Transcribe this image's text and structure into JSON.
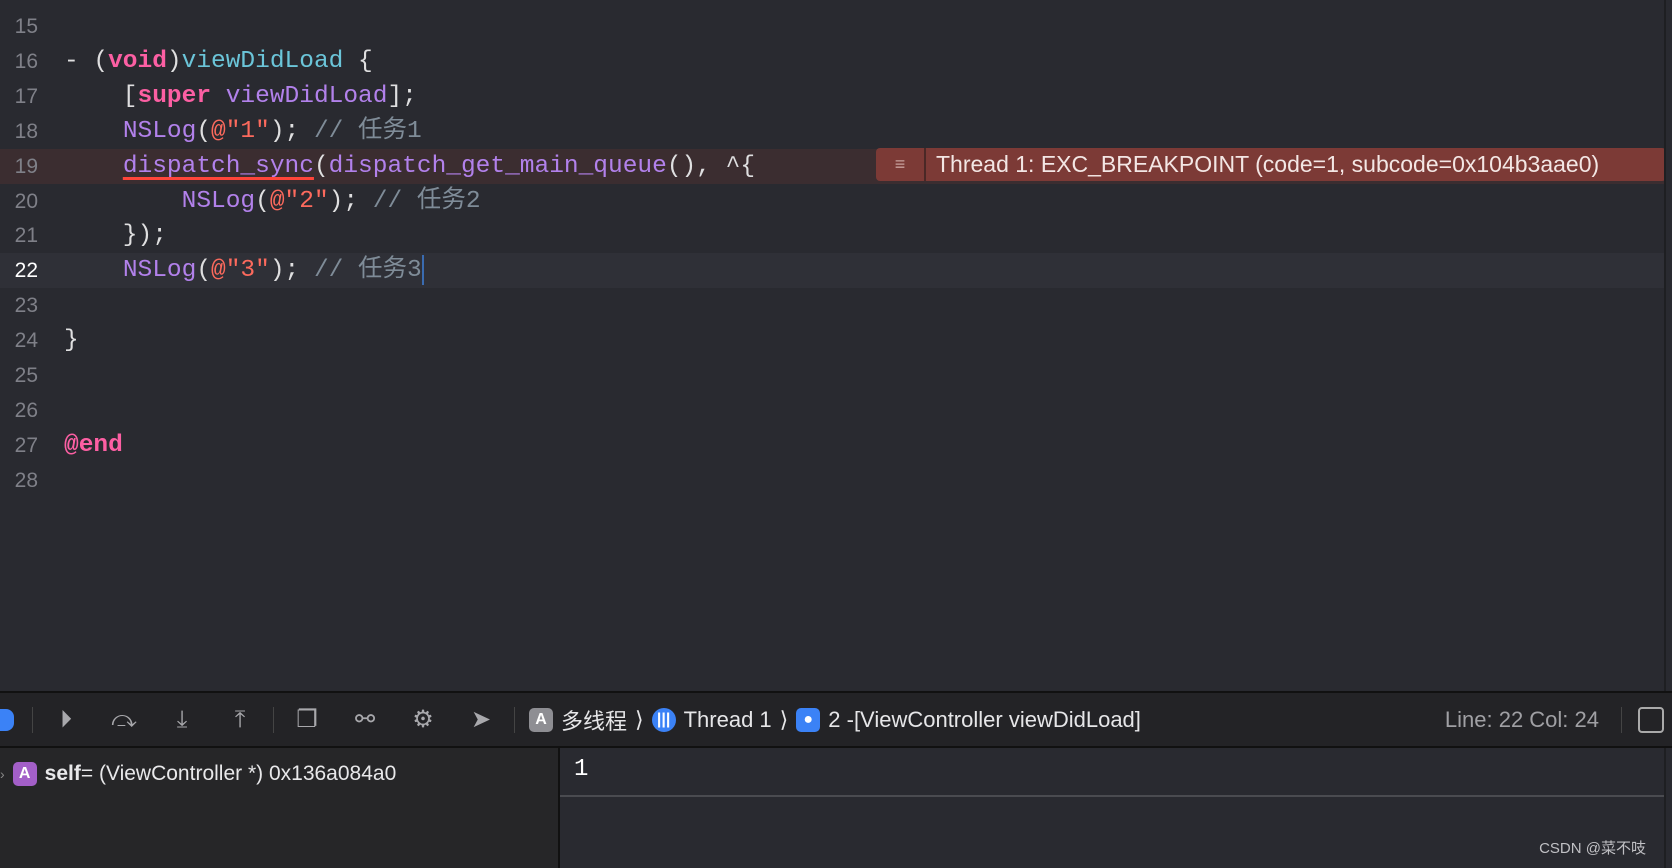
{
  "editor": {
    "lines": [
      {
        "n": "15",
        "tokens": []
      },
      {
        "n": "16",
        "tokens": [
          [
            "- (",
            "pl"
          ],
          [
            "void",
            "kw"
          ],
          [
            ")",
            "pl"
          ],
          [
            "viewDidLoad",
            "fn"
          ],
          [
            " {",
            "pl"
          ]
        ]
      },
      {
        "n": "17",
        "tokens": [
          [
            "    [",
            "pl"
          ],
          [
            "super",
            "kw"
          ],
          [
            " viewDidLoad",
            "mt"
          ],
          [
            "];",
            "pl"
          ]
        ]
      },
      {
        "n": "18",
        "tokens": [
          [
            "    ",
            "pl"
          ],
          [
            "NSLog",
            "mt"
          ],
          [
            "(",
            "pl"
          ],
          [
            "@\"1\"",
            "str"
          ],
          [
            "); ",
            "pl"
          ],
          [
            "// 任务1",
            "cm"
          ]
        ]
      },
      {
        "n": "19",
        "tokens": [
          [
            "    ",
            "pl"
          ],
          [
            "dispatch_sync",
            "mt ul"
          ],
          [
            "(",
            "pl"
          ],
          [
            "dispatch_get_main_queue",
            "mt"
          ],
          [
            "(), ^{",
            "pl"
          ]
        ],
        "state": "err"
      },
      {
        "n": "20",
        "tokens": [
          [
            "        ",
            "pl"
          ],
          [
            "NSLog",
            "mt"
          ],
          [
            "(",
            "pl"
          ],
          [
            "@\"2\"",
            "str"
          ],
          [
            "); ",
            "pl"
          ],
          [
            "// 任务2",
            "cm"
          ]
        ]
      },
      {
        "n": "21",
        "tokens": [
          [
            "    });",
            "pl"
          ]
        ]
      },
      {
        "n": "22",
        "tokens": [
          [
            "    ",
            "pl"
          ],
          [
            "NSLog",
            "mt"
          ],
          [
            "(",
            "pl"
          ],
          [
            "@\"3\"",
            "str"
          ],
          [
            "); ",
            "pl"
          ],
          [
            "// 任务3",
            "cm"
          ]
        ],
        "state": "cur"
      },
      {
        "n": "23",
        "tokens": []
      },
      {
        "n": "24",
        "tokens": [
          [
            "}",
            "pl"
          ]
        ]
      },
      {
        "n": "25",
        "tokens": []
      },
      {
        "n": "26",
        "tokens": []
      },
      {
        "n": "27",
        "tokens": [
          [
            "@end",
            "kw"
          ]
        ]
      },
      {
        "n": "28",
        "tokens": []
      }
    ],
    "error_message": "Thread 1: EXC_BREAKPOINT (code=1, subcode=0x104b3aae0)"
  },
  "toolbar": {
    "crumbs": [
      {
        "label": "多线程",
        "icon": "app-icon",
        "color": "#8e8e93",
        "glyph": "A"
      },
      {
        "label": "Thread 1",
        "icon": "thread-icon",
        "color": "#3b82f6",
        "glyph": "|||"
      },
      {
        "label": "2 -[ViewController viewDidLoad]",
        "icon": "user-frame-icon",
        "color": "#3b82f6",
        "glyph": "●"
      }
    ],
    "separator": "⟩",
    "line_col": "Line: 22  Col: 24"
  },
  "variables": {
    "badge": "A",
    "name": "self",
    "value": " = (ViewController *) 0x136a084a0"
  },
  "console": {
    "output": "1"
  },
  "watermark": "CSDN @菜不吱"
}
